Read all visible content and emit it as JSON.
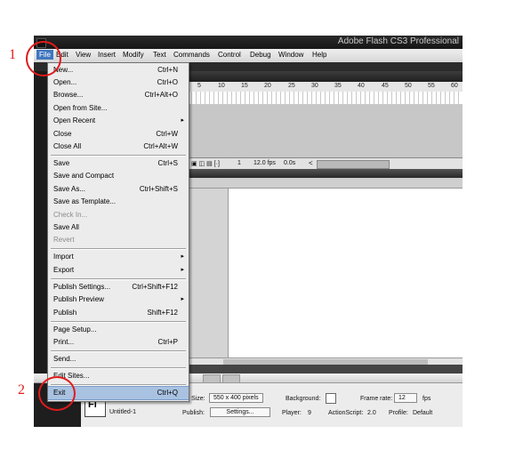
{
  "window": {
    "title": "Adobe Flash CS3 Professional"
  },
  "menubar": [
    "File",
    "Edit",
    "View",
    "Insert",
    "Modify",
    "Text",
    "Commands",
    "Control",
    "Debug",
    "Window",
    "Help"
  ],
  "timeline": {
    "ruler_numbers": [
      "5",
      "10",
      "15",
      "20",
      "25",
      "30",
      "35",
      "40",
      "45",
      "50",
      "55",
      "60"
    ],
    "status": {
      "frame": "1",
      "fps": "12.0 fps",
      "time": "0.0s"
    }
  },
  "file_menu": {
    "items": [
      {
        "label": "New...",
        "shortcut": "Ctrl+N"
      },
      {
        "label": "Open...",
        "shortcut": "Ctrl+O"
      },
      {
        "label": "Browse...",
        "shortcut": "Ctrl+Alt+O"
      },
      {
        "label": "Open from Site...",
        "shortcut": ""
      },
      {
        "label": "Open Recent",
        "shortcut": "",
        "submenu": true
      },
      {
        "label": "Close",
        "shortcut": "Ctrl+W"
      },
      {
        "label": "Close All",
        "shortcut": "Ctrl+Alt+W"
      },
      {
        "label": "Save",
        "shortcut": "Ctrl+S"
      },
      {
        "label": "Save and Compact",
        "shortcut": ""
      },
      {
        "label": "Save As...",
        "shortcut": "Ctrl+Shift+S"
      },
      {
        "label": "Save as Template...",
        "shortcut": ""
      },
      {
        "label": "Check In...",
        "shortcut": "",
        "disabled": true
      },
      {
        "label": "Save All",
        "shortcut": ""
      },
      {
        "label": "Revert",
        "shortcut": "",
        "disabled": true
      },
      {
        "label": "Import",
        "shortcut": "",
        "submenu": true
      },
      {
        "label": "Export",
        "shortcut": "",
        "submenu": true
      },
      {
        "label": "Publish Settings...",
        "shortcut": "Ctrl+Shift+F12"
      },
      {
        "label": "Publish Preview",
        "shortcut": "",
        "submenu": true
      },
      {
        "label": "Publish",
        "shortcut": "Shift+F12"
      },
      {
        "label": "Page Setup...",
        "shortcut": ""
      },
      {
        "label": "Print...",
        "shortcut": "Ctrl+P"
      },
      {
        "label": "Send...",
        "shortcut": ""
      },
      {
        "label": "Edit Sites...",
        "shortcut": ""
      },
      {
        "label": "Exit",
        "shortcut": "Ctrl+Q",
        "highlighted": true
      }
    ]
  },
  "properties": {
    "logo": "Fl",
    "document_name": "Untitled-1",
    "size_label": "Size:",
    "size_value": "550 x 400 pixels",
    "background_label": "Background:",
    "frame_rate_label": "Frame rate:",
    "frame_rate_value": "12",
    "fps_unit": "fps",
    "publish_label": "Publish:",
    "settings_button": "Settings...",
    "player_label": "Player:",
    "player_value": "9",
    "actionscript_label": "ActionScript:",
    "actionscript_value": "2.0",
    "profile_label": "Profile:",
    "profile_value": "Default"
  },
  "annotations": {
    "step1": "1",
    "step2": "2",
    "color": "#e01b1b"
  }
}
